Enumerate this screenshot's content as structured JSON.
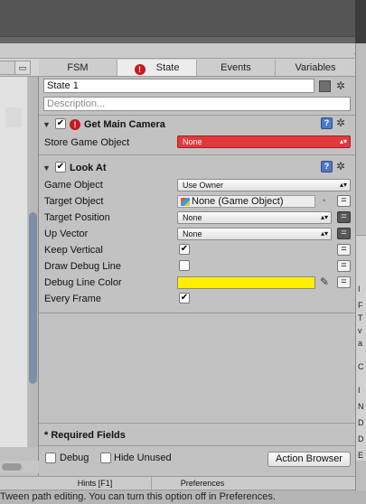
{
  "colors": {
    "panel": "#c2c2c2",
    "error_red": "#e3393c",
    "debug_line_color": "#ffee00",
    "accent_blue": "#4d78c8",
    "warning": "#c8171e"
  },
  "tabs": [
    {
      "label": "FSM"
    },
    {
      "label": "State",
      "warning_icon": "!"
    },
    {
      "label": "Events"
    },
    {
      "label": "Variables"
    }
  ],
  "state": {
    "name": "State 1",
    "description_placeholder": "Description..."
  },
  "actions": [
    {
      "title": "Get Main Camera",
      "enabled": true,
      "has_error": true,
      "error_icon": "!",
      "fields": [
        {
          "label": "Store Game Object",
          "value": "None"
        }
      ]
    },
    {
      "title": "Look At",
      "enabled": true,
      "fields": [
        {
          "label": "Game Object",
          "value": "Use Owner"
        },
        {
          "label": "Target Object",
          "value": "None (Game Object)"
        },
        {
          "label": "Target Position",
          "value": "None"
        },
        {
          "label": "Up Vector",
          "value": "None"
        },
        {
          "label": "Keep Vertical",
          "checked": true
        },
        {
          "label": "Draw Debug Line",
          "checked": false
        },
        {
          "label": "Debug Line Color",
          "value": "#ffee00"
        },
        {
          "label": "Every Frame",
          "checked": true
        }
      ]
    }
  ],
  "icons": {
    "gear": "gear-icon",
    "help": "help-icon",
    "menu": "menu-icon",
    "eyedropper": "eyedropper-icon",
    "check": "✔"
  },
  "bottom": {
    "required_fields": "* Required Fields",
    "debug_label": "Debug",
    "hide_unused_label": "Hide Unused",
    "action_browser_label": "Action Browser"
  },
  "footer": {
    "hints": "Hints [F1]",
    "preferences": "Preferences"
  },
  "status_text": "Tween path editing. You can turn this option off in Preferences.",
  "right_edge_letters": [
    "I",
    "F",
    "T",
    "v",
    "a",
    "C",
    "I",
    "N",
    "D",
    "D",
    "E"
  ]
}
